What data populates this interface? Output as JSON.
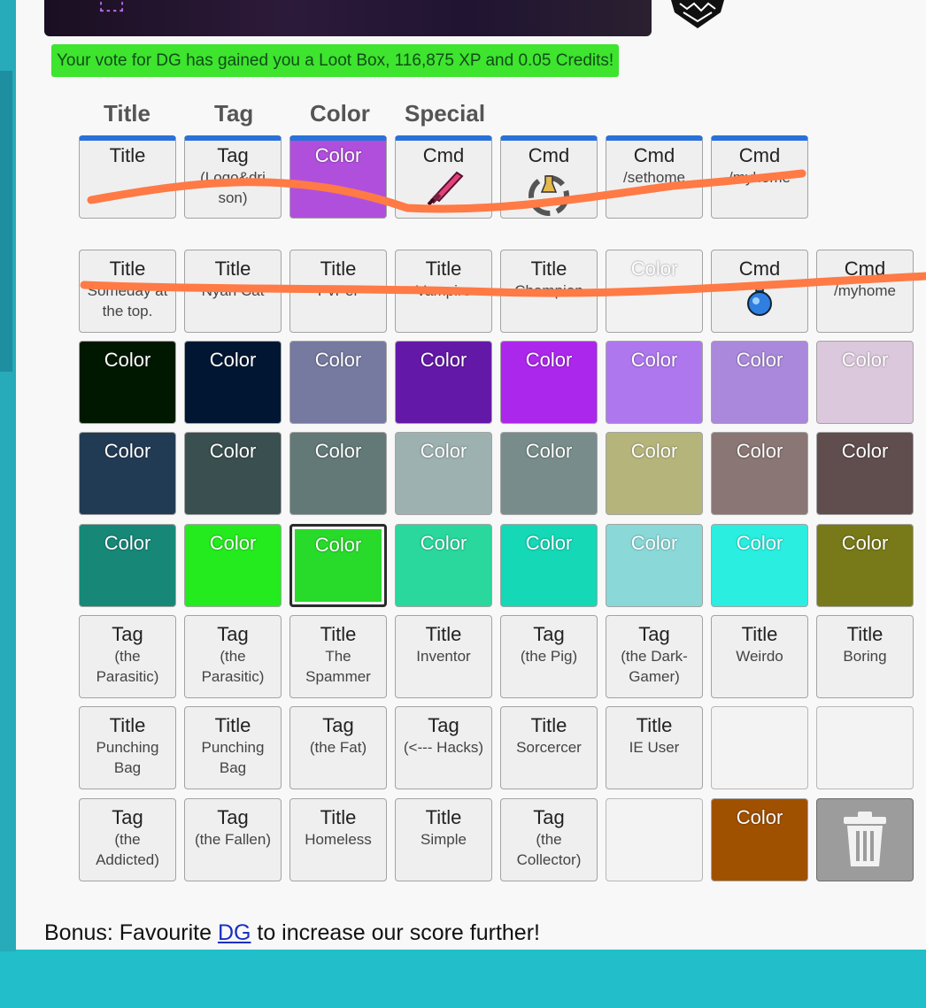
{
  "notice": "Your vote for DG has gained you a Loot Box, 116,875 XP and 0.05 Credits!",
  "headers": [
    "Title",
    "Tag",
    "Color",
    "Special"
  ],
  "equipped": [
    {
      "kind": "Title",
      "value": "",
      "bg": "#efefef"
    },
    {
      "kind": "Tag",
      "value": "(Logo&dri son)",
      "bg": "#efefef"
    },
    {
      "kind": "Color",
      "value": "",
      "bg": "#b14fdd"
    },
    {
      "kind": "Cmd",
      "value": "",
      "bg": "#efefef",
      "icon": "pink-sword-icon"
    },
    {
      "kind": "Cmd",
      "value": "",
      "bg": "#efefef",
      "icon": "recycle-potion-icon"
    },
    {
      "kind": "Cmd",
      "value": "/sethome",
      "bg": "#efefef"
    },
    {
      "kind": "Cmd",
      "value": "/myhome",
      "bg": "#efefef"
    }
  ],
  "inventory": [
    [
      {
        "kind": "Title",
        "value": "Someday at the top.",
        "bg": "#efefef"
      },
      {
        "kind": "Title",
        "value": "Nyan Cat",
        "bg": "#efefef"
      },
      {
        "kind": "Title",
        "value": "PvPer",
        "bg": "#efefef"
      },
      {
        "kind": "Title",
        "value": "Vampire",
        "bg": "#efefef"
      },
      {
        "kind": "Title",
        "value": "Champion",
        "bg": "#efefef"
      },
      {
        "kind": "Color",
        "value": "",
        "bg": "#f2f2f2",
        "light": true
      },
      {
        "kind": "Cmd",
        "value": "",
        "bg": "#efefef",
        "icon": "blue-potion-icon"
      },
      {
        "kind": "Cmd",
        "value": "/myhome",
        "bg": "#efefef"
      }
    ],
    [
      {
        "kind": "Color",
        "value": "",
        "bg": "#001800"
      },
      {
        "kind": "Color",
        "value": "",
        "bg": "#001633"
      },
      {
        "kind": "Color",
        "value": "",
        "bg": "#767aa1"
      },
      {
        "kind": "Color",
        "value": "",
        "bg": "#6418a8"
      },
      {
        "kind": "Color",
        "value": "",
        "bg": "#ac27ec"
      },
      {
        "kind": "Color",
        "value": "",
        "bg": "#ae77ee"
      },
      {
        "kind": "Color",
        "value": "",
        "bg": "#aa88dc"
      },
      {
        "kind": "Color",
        "value": "",
        "bg": "#dcc8dc",
        "light": true
      }
    ],
    [
      {
        "kind": "Color",
        "value": "",
        "bg": "#223b55"
      },
      {
        "kind": "Color",
        "value": "",
        "bg": "#3a4f50"
      },
      {
        "kind": "Color",
        "value": "",
        "bg": "#627977"
      },
      {
        "kind": "Color",
        "value": "",
        "bg": "#9db1b1",
        "light": true
      },
      {
        "kind": "Color",
        "value": "",
        "bg": "#788d8b"
      },
      {
        "kind": "Color",
        "value": "",
        "bg": "#b5b57b",
        "light": true
      },
      {
        "kind": "Color",
        "value": "",
        "bg": "#8a7674"
      },
      {
        "kind": "Color",
        "value": "",
        "bg": "#604d4d"
      }
    ],
    [
      {
        "kind": "Color",
        "value": "",
        "bg": "#178878"
      },
      {
        "kind": "Color",
        "value": "",
        "bg": "#24eb1e",
        "light": true
      },
      {
        "kind": "Color",
        "value": "",
        "bg": "#28db2b",
        "light": true,
        "selected": true
      },
      {
        "kind": "Color",
        "value": "",
        "bg": "#2ad79d",
        "light": true
      },
      {
        "kind": "Color",
        "value": "",
        "bg": "#14d8b6",
        "light": true
      },
      {
        "kind": "Color",
        "value": "",
        "bg": "#8ad8d8",
        "light": true
      },
      {
        "kind": "Color",
        "value": "",
        "bg": "#29eee0",
        "light": true
      },
      {
        "kind": "Color",
        "value": "",
        "bg": "#787918"
      }
    ],
    [
      {
        "kind": "Tag",
        "value": "(the Parasitic)",
        "bg": "#efefef"
      },
      {
        "kind": "Tag",
        "value": "(the Parasitic)",
        "bg": "#efefef"
      },
      {
        "kind": "Title",
        "value": "The Spammer",
        "bg": "#efefef"
      },
      {
        "kind": "Title",
        "value": "Inventor",
        "bg": "#efefef"
      },
      {
        "kind": "Tag",
        "value": "(the Pig)",
        "bg": "#efefef"
      },
      {
        "kind": "Tag",
        "value": "(the Dark-Gamer)",
        "bg": "#efefef"
      },
      {
        "kind": "Title",
        "value": "Weirdo",
        "bg": "#efefef"
      },
      {
        "kind": "Title",
        "value": "Boring",
        "bg": "#efefef"
      }
    ],
    [
      {
        "kind": "Title",
        "value": "Punching Bag",
        "bg": "#efefef"
      },
      {
        "kind": "Title",
        "value": "Punching Bag",
        "bg": "#efefef"
      },
      {
        "kind": "Tag",
        "value": "(the Fat)",
        "bg": "#efefef"
      },
      {
        "kind": "Tag",
        "value": "(<--- Hacks)",
        "bg": "#efefef"
      },
      {
        "kind": "Title",
        "value": "Sorcercer",
        "bg": "#efefef"
      },
      {
        "kind": "Title",
        "value": "IE User",
        "bg": "#efefef"
      },
      {
        "kind": "",
        "value": "",
        "bg": "#f3f3f3",
        "empty": true
      },
      {
        "kind": "",
        "value": "",
        "bg": "#f3f3f3",
        "empty": true
      }
    ],
    [
      {
        "kind": "Tag",
        "value": "(the Addicted)",
        "bg": "#efefef"
      },
      {
        "kind": "Tag",
        "value": "(the Fallen)",
        "bg": "#efefef"
      },
      {
        "kind": "Title",
        "value": "Homeless",
        "bg": "#efefef"
      },
      {
        "kind": "Title",
        "value": "Simple",
        "bg": "#efefef"
      },
      {
        "kind": "Tag",
        "value": "(the Collector)",
        "bg": "#efefef"
      },
      {
        "kind": "",
        "value": "",
        "bg": "#f3f3f3",
        "empty": true
      },
      {
        "kind": "Color",
        "value": "",
        "bg": "#a05100"
      },
      {
        "kind": "",
        "value": "",
        "bg": "#9c9c9c",
        "icon": "trash-icon",
        "trash": true
      }
    ]
  ],
  "bonus": {
    "prefix": "Bonus: Favourite ",
    "link": "DG",
    "suffix": " to increase our score further!"
  }
}
